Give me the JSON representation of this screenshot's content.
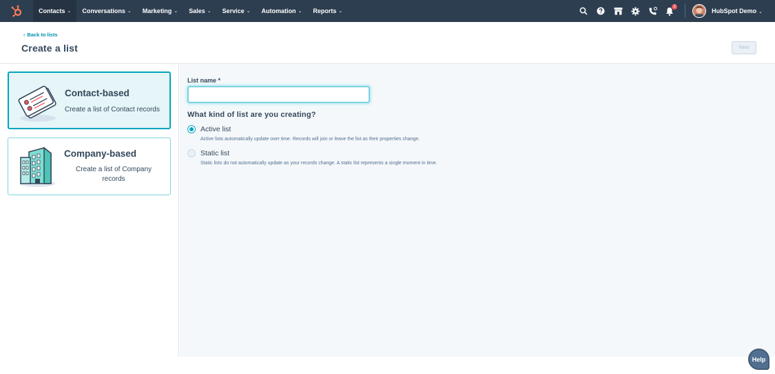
{
  "nav": {
    "items": [
      {
        "label": "Contacts",
        "active": true
      },
      {
        "label": "Conversations",
        "active": false
      },
      {
        "label": "Marketing",
        "active": false
      },
      {
        "label": "Sales",
        "active": false
      },
      {
        "label": "Service",
        "active": false
      },
      {
        "label": "Automation",
        "active": false
      },
      {
        "label": "Reports",
        "active": false
      }
    ],
    "caret": "⌄",
    "notifications_count": "2",
    "account_name": "HubSpot Demo",
    "icons": [
      "search-icon",
      "help-icon",
      "marketplace-icon",
      "settings-icon",
      "calling-icon",
      "notifications-icon"
    ],
    "accent_color": "#ff7a59",
    "bar_color": "#2d3e50"
  },
  "header": {
    "back_label": "Back to lists",
    "title": "Create a list",
    "next_label": "Next"
  },
  "types": [
    {
      "title": "Contact-based",
      "description": "Create a list of Contact records",
      "selected": true,
      "icon": "contact-cards-icon"
    },
    {
      "title": "Company-based",
      "description": "Create a list of Company records",
      "selected": false,
      "icon": "building-icon"
    }
  ],
  "form": {
    "name_label": "List name *",
    "name_value": "",
    "question": "What kind of list are you creating?",
    "options": [
      {
        "label": "Active list",
        "help": "Active lists automatically update over time. Records will join or leave the list as their properties change.",
        "checked": true
      },
      {
        "label": "Static list",
        "help": "Static lists do not automatically update as your records change. A static list represents a single moment in time.",
        "checked": false
      }
    ]
  },
  "help_label": "Help"
}
